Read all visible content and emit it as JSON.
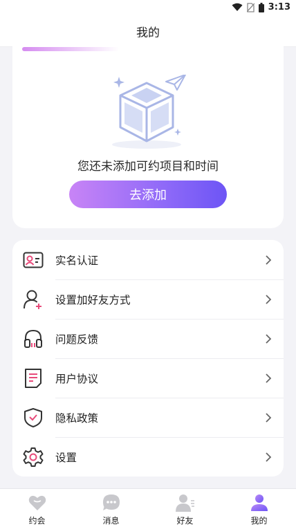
{
  "status_bar": {
    "time": "3:13"
  },
  "header": {
    "title": "我的"
  },
  "empty_state": {
    "message": "您还未添加可约项目和时间",
    "button_label": "去添加"
  },
  "menu": {
    "items": [
      {
        "label": "实名认证",
        "icon": "id-card-icon"
      },
      {
        "label": "设置加好友方式",
        "icon": "add-user-icon"
      },
      {
        "label": "问题反馈",
        "icon": "headset-icon"
      },
      {
        "label": "用户协议",
        "icon": "document-icon"
      },
      {
        "label": "隐私政策",
        "icon": "shield-icon"
      },
      {
        "label": "设置",
        "icon": "gear-icon"
      }
    ]
  },
  "tabs": [
    {
      "label": "约会",
      "icon": "heart-icon",
      "active": false
    },
    {
      "label": "消息",
      "icon": "chat-bubble-icon",
      "active": false
    },
    {
      "label": "好友",
      "icon": "friends-icon",
      "active": false
    },
    {
      "label": "我的",
      "icon": "profile-icon",
      "active": true
    }
  ],
  "colors": {
    "accent": "#7a5cf6",
    "icon_stroke": "#333333",
    "icon_accent": "#e84a7a",
    "tab_inactive": "#c8c8cc"
  }
}
